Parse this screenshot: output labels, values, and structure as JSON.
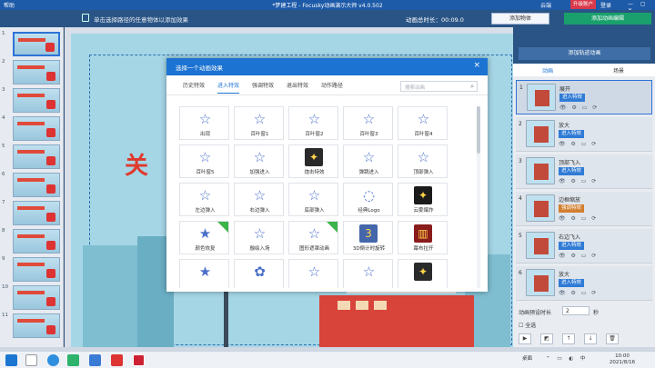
{
  "window": {
    "title": "*梦建工程 - Focusky动画演示大师 v4.0.502",
    "menu_help": "帮助",
    "cloud": "云端",
    "upgrade": "升级账户",
    "login": "登录"
  },
  "toolbar": {
    "tip": "单击选择路径的任意物体以添加效果",
    "duration": "动画总时长：00:09.0",
    "add_object": "添加物体",
    "add_animation": "添加动画编辑"
  },
  "slides": [
    {
      "num": "1"
    },
    {
      "num": "2"
    },
    {
      "num": "3"
    },
    {
      "num": "4"
    },
    {
      "num": "5"
    },
    {
      "num": "6"
    },
    {
      "num": "7"
    },
    {
      "num": "8"
    },
    {
      "num": "9"
    },
    {
      "num": "10"
    },
    {
      "num": "11"
    }
  ],
  "canvas": {
    "title_partial": "关"
  },
  "dialog": {
    "title": "选择一个动画效果",
    "close": "×",
    "tabs": [
      "历史特效",
      "进入特效",
      "强调特效",
      "退出特效",
      "动作路径"
    ],
    "active_tab": "进入特效",
    "search_placeholder": "搜索动画",
    "search_icon": "⌕",
    "effects": [
      {
        "label": "出现",
        "icon": "☆"
      },
      {
        "label": "百叶窗1",
        "icon": "☆"
      },
      {
        "label": "百叶窗2",
        "icon": "☆"
      },
      {
        "label": "百叶窗3",
        "icon": "☆"
      },
      {
        "label": "百叶窗4",
        "icon": "☆"
      },
      {
        "label": "百叶窗5",
        "icon": "☆"
      },
      {
        "label": "加强进入",
        "icon": "☆"
      },
      {
        "label": "炮击特效",
        "icon": "✦"
      },
      {
        "label": "弹跳进入",
        "icon": "☆"
      },
      {
        "label": "顶部弹入",
        "icon": "☆"
      },
      {
        "label": "左边弹入",
        "icon": "☆"
      },
      {
        "label": "右边弹入",
        "icon": "☆"
      },
      {
        "label": "底部弹入",
        "icon": "☆"
      },
      {
        "label": "经典Logo",
        "icon": "◌"
      },
      {
        "label": "云雾爆炸",
        "icon": "✦"
      },
      {
        "label": "颜色恢复",
        "icon": "★",
        "new": true
      },
      {
        "label": "融绘入场",
        "icon": "☆"
      },
      {
        "label": "图形遮罩动画",
        "icon": "☆",
        "new": true
      },
      {
        "label": "3D倒计时旋转",
        "icon": "3"
      },
      {
        "label": "幕布拉开",
        "icon": "▥"
      },
      {
        "label": "",
        "icon": "★"
      },
      {
        "label": "",
        "icon": "✿"
      },
      {
        "label": "",
        "icon": "☆"
      },
      {
        "label": "",
        "icon": "☆"
      },
      {
        "label": "",
        "icon": "✦"
      }
    ]
  },
  "right_panel": {
    "add_path": "添加轨迹动画",
    "tabs": [
      "动画",
      "场景"
    ],
    "items": [
      {
        "num": "1",
        "name": "展开",
        "type": "进入特效",
        "kind": "enter"
      },
      {
        "num": "2",
        "name": "放大",
        "type": "进入特效",
        "kind": "enter"
      },
      {
        "num": "3",
        "name": "顶部飞入",
        "type": "进入特效",
        "kind": "enter"
      },
      {
        "num": "4",
        "name": "边框缩放",
        "type": "强调特效",
        "kind": "emph"
      },
      {
        "num": "5",
        "name": "右边飞入",
        "type": "进入特效",
        "kind": "enter"
      },
      {
        "num": "6",
        "name": "放大",
        "type": "进入特效",
        "kind": "enter"
      }
    ],
    "ctrl_icons": "👁 ⚙ ▭ ⟳",
    "preset_label": "动画预设时长",
    "preset_value": "2",
    "preset_unit": "秒",
    "select_all": "☐ 全选",
    "bottom_icons": [
      "▶",
      "◩",
      "↑",
      "↓",
      "🗑"
    ]
  },
  "taskbar": {
    "lang": "桌面",
    "time": "10:00",
    "date": "2021/8/16"
  },
  "colors": {
    "title_bar": "#1d5aa8",
    "accent": "#1c73d2",
    "green": "#19a06c",
    "upgrade": "#d9394a"
  }
}
